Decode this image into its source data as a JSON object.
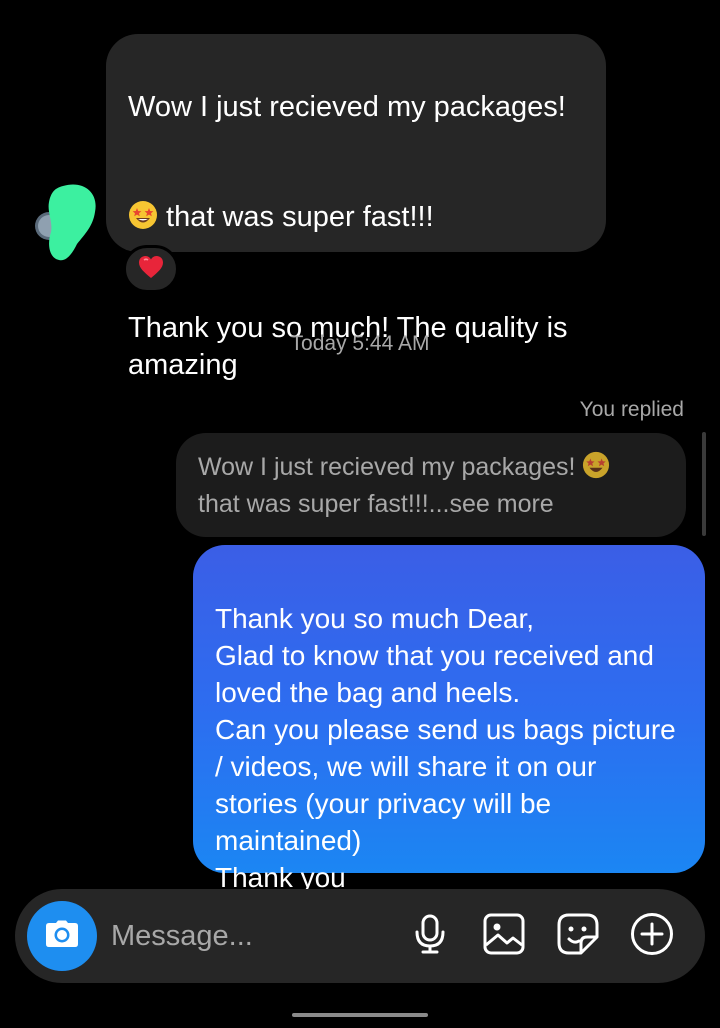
{
  "incoming": {
    "line1": "Wow I just recieved my packages!",
    "line2_emoji": "star-struck-emoji",
    "line2_text": " that was super fast!!!",
    "line3": "Thank you so much! The quality is amazing",
    "reaction": "heart-emoji"
  },
  "timestamp": "Today 5:44 AM",
  "reply": {
    "label": "You replied",
    "preview_line1": "Wow I just recieved my packages!",
    "preview_line2": "that was super fast!!!...see more"
  },
  "outgoing": {
    "text": "Thank you so much Dear,\nGlad to know that you received and loved the bag and heels.\nCan you please send us bags picture / videos, we will share it on our stories (your privacy will be maintained)\nThank you"
  },
  "composer": {
    "placeholder": "Message...",
    "icons": [
      "camera-icon",
      "microphone-icon",
      "gallery-icon",
      "sticker-icon",
      "plus-circle-icon"
    ]
  },
  "colors": {
    "background": "#000000",
    "incoming_bubble": "#262626",
    "outgoing_gradient_top": "#3b5ee6",
    "outgoing_gradient_bottom": "#1b86f3",
    "camera_button": "#1e8ef0",
    "avatar_overlay": "#3cf0a0"
  }
}
